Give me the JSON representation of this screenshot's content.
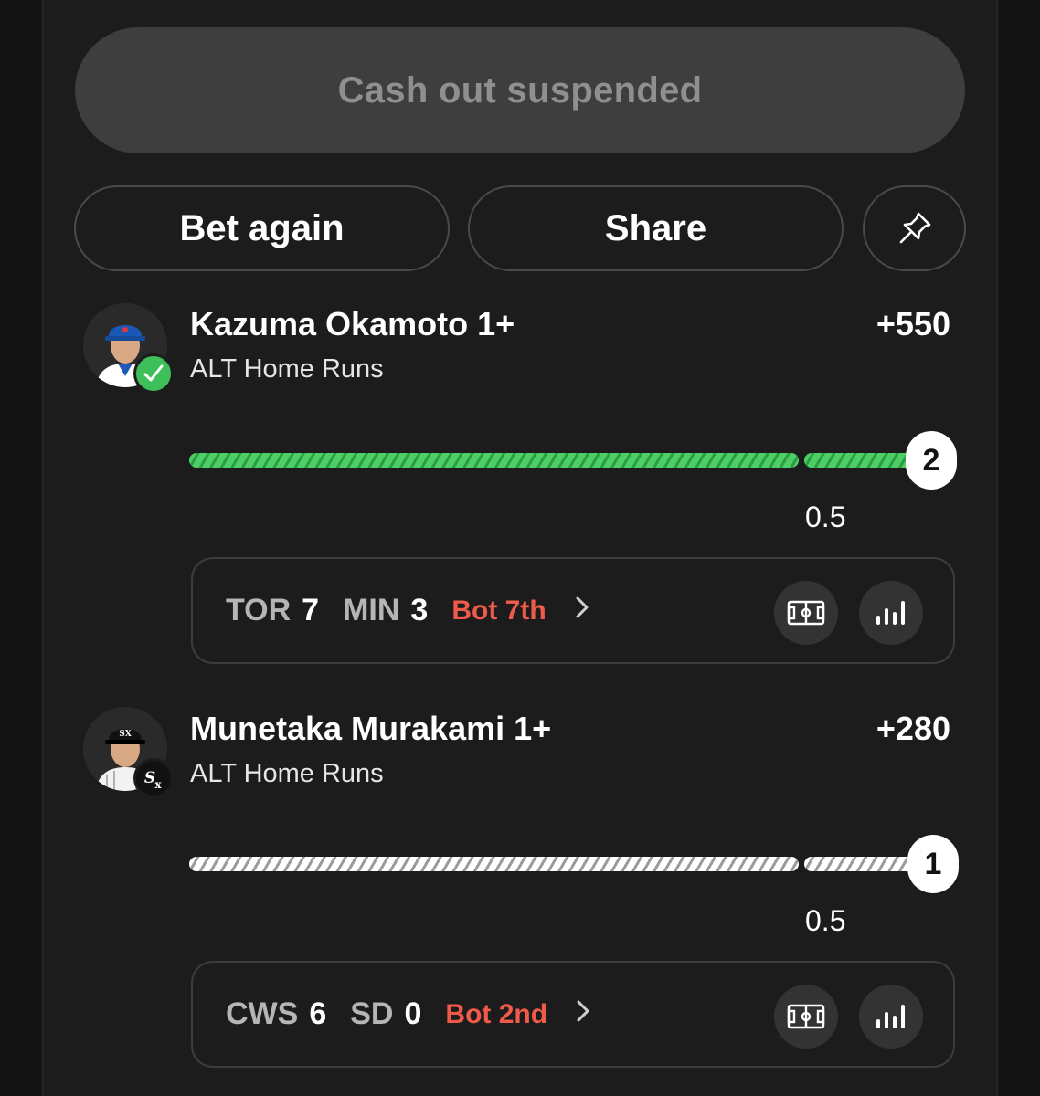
{
  "cashout": {
    "label": "Cash out suspended"
  },
  "actions": {
    "bet_again": "Bet again",
    "share": "Share",
    "pin_icon": "pin-icon"
  },
  "legs": [
    {
      "player": "Kazuma Okamoto 1+",
      "market": "ALT Home Runs",
      "odds": "+550",
      "status": "won",
      "progress_value": "2",
      "threshold": "0.5",
      "bar_color": "#4cd066",
      "game": {
        "away": "TOR",
        "away_score": "7",
        "home": "MIN",
        "home_score": "3",
        "inning": "Bot 7th"
      }
    },
    {
      "player": "Munetaka Murakami 1+",
      "market": "ALT Home Runs",
      "odds": "+280",
      "status": "won",
      "progress_value": "1",
      "threshold": "0.5",
      "bar_color": "#ffffff",
      "game": {
        "away": "CWS",
        "away_score": "6",
        "home": "SD",
        "home_score": "0",
        "inning": "Bot 2nd"
      }
    }
  ],
  "colors": {
    "accent_green": "#3fbf5a",
    "live_red": "#ef5a4a",
    "background": "#1c1c1c"
  }
}
